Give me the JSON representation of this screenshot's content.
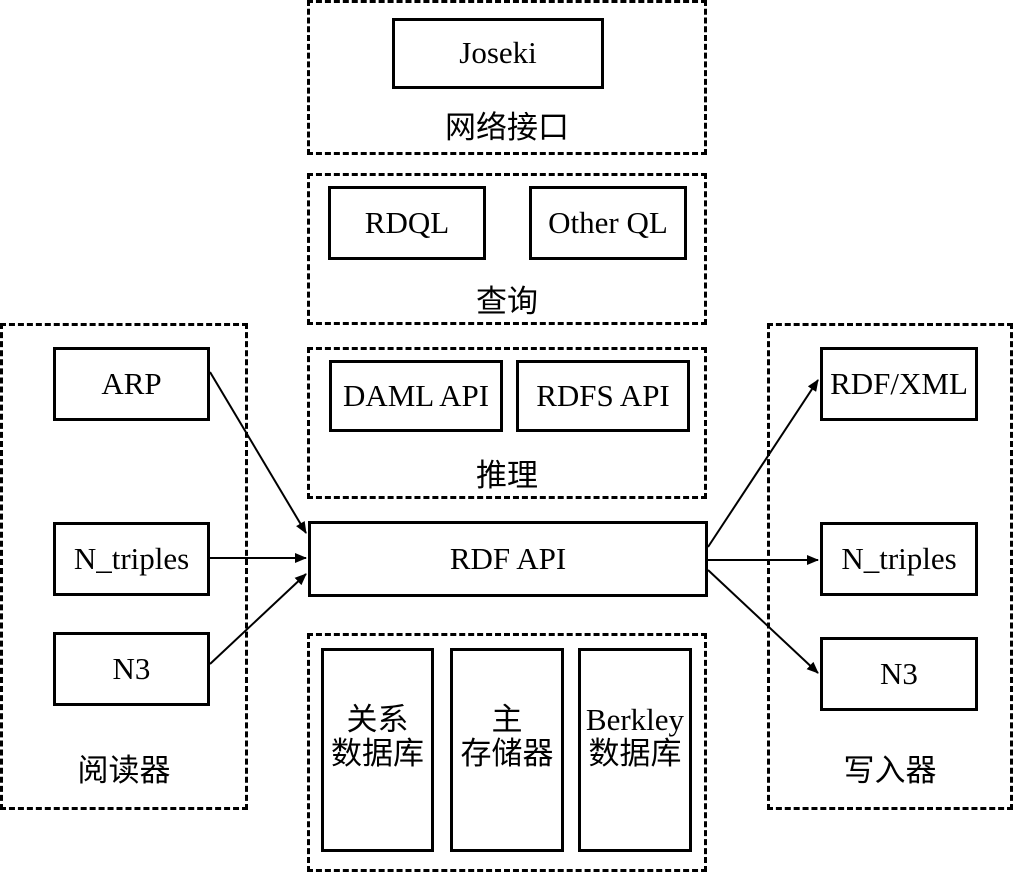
{
  "network": {
    "label": "网络接口",
    "joseki": "Joseki"
  },
  "query": {
    "label": "查询",
    "rdql": "RDQL",
    "other_ql": "Other QL"
  },
  "inference": {
    "label": "推理",
    "daml_api": "DAML API",
    "rdfs_api": "RDFS API"
  },
  "reader": {
    "label": "阅读器",
    "items": [
      "ARP",
      "N_triples",
      "N3"
    ]
  },
  "rdf_api": "RDF API",
  "writer": {
    "label": "写入器",
    "items": [
      "RDF/XML",
      "N_triples",
      "N3"
    ]
  },
  "storage": {
    "items": [
      "关系\n数据库",
      "主\n存储器",
      "Berkley\n数据库"
    ]
  }
}
